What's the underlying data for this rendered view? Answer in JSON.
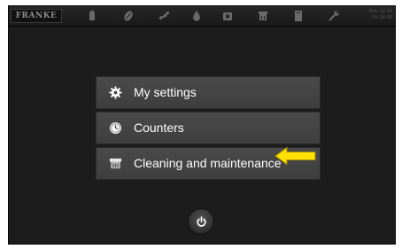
{
  "topbar": {
    "logo": "FRANKE",
    "icons": [
      "cup-icon",
      "coffee-bean-icon",
      "beans-icon",
      "drop-icon",
      "gear-box-icon",
      "brewing-unit-icon",
      "book-icon",
      "wrench-icon"
    ],
    "status_line1": "Mon 12:34",
    "status_line2": "Fri 14:09"
  },
  "menu": {
    "items": [
      {
        "label": "My settings",
        "icon": "gear-icon"
      },
      {
        "label": "Counters",
        "icon": "counter-dial-icon"
      },
      {
        "label": "Cleaning and maintenance",
        "icon": "cleaning-icon"
      }
    ]
  },
  "colors": {
    "background": "#1c1c1c",
    "menu_item": "#444444",
    "text": "#ffffff",
    "arrow": "#ffe000"
  },
  "power": {
    "icon": "power-icon"
  }
}
